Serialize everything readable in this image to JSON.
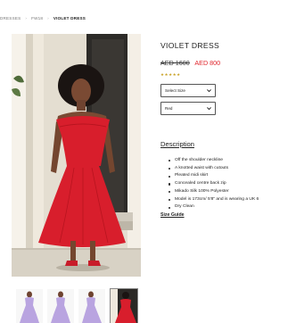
{
  "breadcrumb": {
    "items": [
      "DRESSES",
      "FW18",
      "VIOLET DRESS"
    ]
  },
  "product": {
    "title": "VIOLET DRESS",
    "old_price": "AED 1600",
    "new_price": "AED 800",
    "rating_stars": "★★★★★",
    "size_select": "Select Size",
    "color_select": "Red"
  },
  "description": {
    "heading": "Description",
    "items": [
      "Off the shoulder neckline",
      "A knotted waist with cutouts",
      "Pleated midi skirt",
      "Concealed centre back zip",
      "Mikado Silk 100% Polyester",
      "Model is 173cm/ 5'8\" and is wearing a UK 6",
      "Dry Clean"
    ],
    "size_guide": "Size Guide"
  },
  "thumbnails": [
    {
      "dress_color": "lavender",
      "active": false
    },
    {
      "dress_color": "lavender",
      "active": false
    },
    {
      "dress_color": "lavender",
      "active": false
    },
    {
      "dress_color": "red",
      "active": true
    }
  ],
  "colors": {
    "accent_red": "#e0262d",
    "dress_red": "#d81e2c",
    "lavender": "#b9a4e0",
    "star_gold": "#c9a227"
  }
}
